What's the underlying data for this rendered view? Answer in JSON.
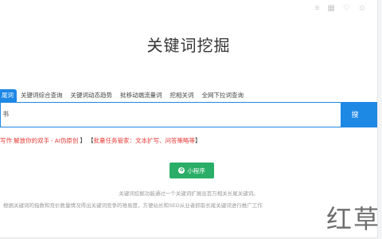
{
  "title": "关键词挖掘",
  "tabs": [
    {
      "label": "尾词",
      "active": true
    },
    {
      "label": "关键词综合查询",
      "active": false
    },
    {
      "label": "关键词动态趋势",
      "active": false
    },
    {
      "label": "批移动端流量词",
      "active": false
    },
    {
      "label": "挖相关词",
      "active": false
    },
    {
      "label": "全网下拉词查询",
      "active": false
    }
  ],
  "search": {
    "value": "书",
    "button_label": "搜 索"
  },
  "promo": {
    "part1": "写作 解放你的双手 - AI伪原创",
    "sep": " 】  【",
    "part2": "批量任务管家：文本扩写、问答策略等",
    "end": "】"
  },
  "mini_program": {
    "label": "小程序"
  },
  "description": {
    "line1": "关键词挖掘功能通过一个关键词扩展出百万相关长尾关键词。",
    "line2": "根据关键词的指数和竞价数量情况得出关键词竞争的难易度，方便站长和SEO从业者抓取长尾关键词进行推广工作"
  },
  "watermark": "红草",
  "colors": {
    "accent": "#1e88e5",
    "promo_red": "#e53935",
    "mini_green": "#2aae67"
  }
}
